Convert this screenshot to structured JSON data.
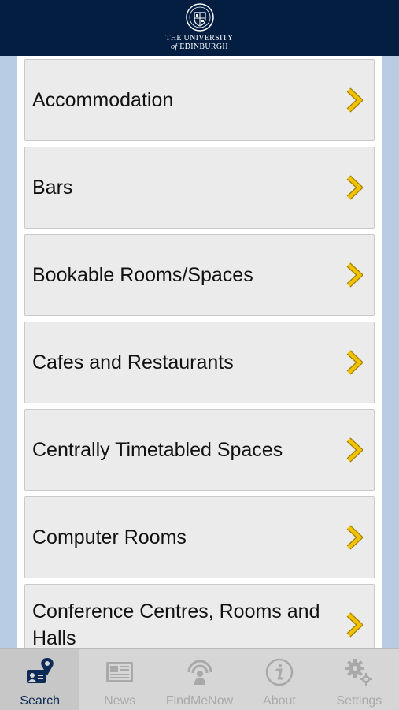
{
  "header": {
    "line1": "THE UNIVERSITY",
    "line2_of": "of",
    "line2_name": "EDINBURGH"
  },
  "categories": [
    {
      "label": "Accommodation"
    },
    {
      "label": "Bars"
    },
    {
      "label": "Bookable Rooms/Spaces"
    },
    {
      "label": "Cafes and Restaurants"
    },
    {
      "label": "Centrally Timetabled Spaces"
    },
    {
      "label": "Computer Rooms"
    },
    {
      "label": "Conference Centres, Rooms and Halls"
    }
  ],
  "tabs": [
    {
      "label": "Search",
      "icon": "search-location-icon",
      "active": true
    },
    {
      "label": "News",
      "icon": "newspaper-icon",
      "active": false
    },
    {
      "label": "FindMeNow",
      "icon": "broadcast-person-icon",
      "active": false
    },
    {
      "label": "About",
      "icon": "info-icon",
      "active": false
    },
    {
      "label": "Settings",
      "icon": "gears-icon",
      "active": false
    }
  ],
  "colors": {
    "header_bg": "#041e42",
    "side_bg": "#b8cce4",
    "item_bg": "#ebebeb",
    "chevron": "#f2c200",
    "tab_active": "#0c2a55",
    "tab_inactive": "#a9a9a9"
  }
}
